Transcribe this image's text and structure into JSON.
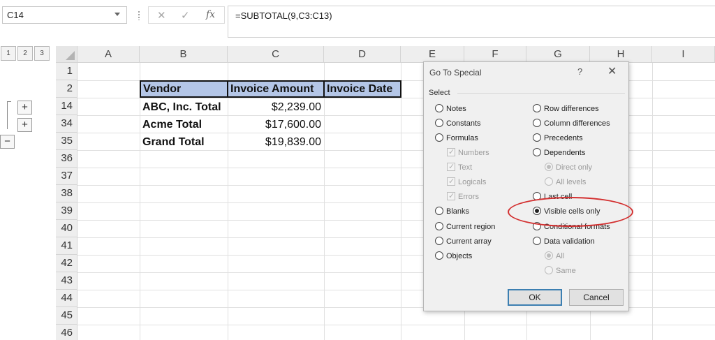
{
  "formula_bar": {
    "name_box": "C14",
    "cancel_icon": "✕",
    "enter_icon": "✓",
    "fx_icon": "fx",
    "formula": "=SUBTOTAL(9,C3:C13)"
  },
  "outline_levels": [
    "1",
    "2",
    "3"
  ],
  "columns": [
    "A",
    "B",
    "C",
    "D",
    "E",
    "F",
    "G",
    "H",
    "I"
  ],
  "rows": [
    "1",
    "2",
    "14",
    "34",
    "35",
    "36",
    "37",
    "38",
    "39",
    "40",
    "41",
    "42",
    "43",
    "44",
    "45",
    "46"
  ],
  "table": {
    "headers": [
      "Vendor",
      "Invoice Amount",
      "Invoice Date"
    ],
    "rows": [
      {
        "vendor": "ABC, Inc. Total",
        "amount": "$2,239.00"
      },
      {
        "vendor": "Acme Total",
        "amount": "$17,600.00"
      },
      {
        "vendor": "Grand Total",
        "amount": "$19,839.00"
      }
    ]
  },
  "outline_buttons": {
    "expand": "+",
    "collapse": "−"
  },
  "dialog": {
    "title": "Go To Special",
    "help": "?",
    "close": "✕",
    "section": "Select",
    "left_options": [
      "Notes",
      "Constants",
      "Formulas",
      "Numbers",
      "Text",
      "Logicals",
      "Errors",
      "Blanks",
      "Current region",
      "Current array",
      "Objects"
    ],
    "right_options": [
      "Row differences",
      "Column differences",
      "Precedents",
      "Dependents",
      "Direct only",
      "All levels",
      "Last cell",
      "Visible cells only",
      "Conditional formats",
      "Data validation",
      "All",
      "Same"
    ],
    "selected_option": "Visible cells only",
    "ok": "OK",
    "cancel": "Cancel"
  },
  "colors": {
    "header_fill": "#b4c6e7",
    "annotation": "#d32f2f",
    "ok_border": "#3c7fb1"
  }
}
